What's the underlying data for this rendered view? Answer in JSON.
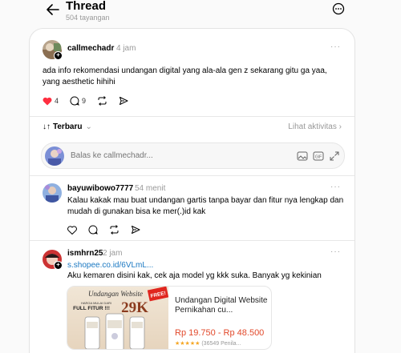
{
  "header": {
    "title": "Thread",
    "views": "504 tayangan"
  },
  "main_post": {
    "username": "callmechadr",
    "time": "4 jam",
    "text": "ada info rekomendasi undangan digital yang ala-ala gen z sekarang gitu ga yaa, yang aesthetic hihihi",
    "likes": "4",
    "comments": "9"
  },
  "sort": {
    "label": "Terbaru",
    "activity_link": "Lihat aktivitas"
  },
  "reply_box": {
    "placeholder": "Balas ke callmechadr..."
  },
  "replies": [
    {
      "username": "bayuwibowo7777",
      "time": "54 menit",
      "text": "Kalau kakak mau buat undangan gartis tanpa bayar dan fitur nya lengkap dan mudah di gunakan bisa ke mer(.)id kak"
    },
    {
      "username": "ismhrn25",
      "time": "2 jam",
      "link": "s.shopee.co.id/6VLmL...",
      "text": "Aku kemaren disini kak, cek aja model yg kkk suka. Banyak yg kekinian",
      "card": {
        "banner_line1": "Undangan Website",
        "banner_line2": "HARGA MULAI DARI",
        "banner_line3": "FULL FITUR !!!",
        "banner_price": "29K",
        "badge": "FREE!",
        "title": "Undangan Digital Website Pernikahan cu...",
        "price": "Rp 19.750 - Rp 48.500",
        "stars": "★★★★★",
        "rating": "(36549 Penila..."
      }
    }
  ]
}
